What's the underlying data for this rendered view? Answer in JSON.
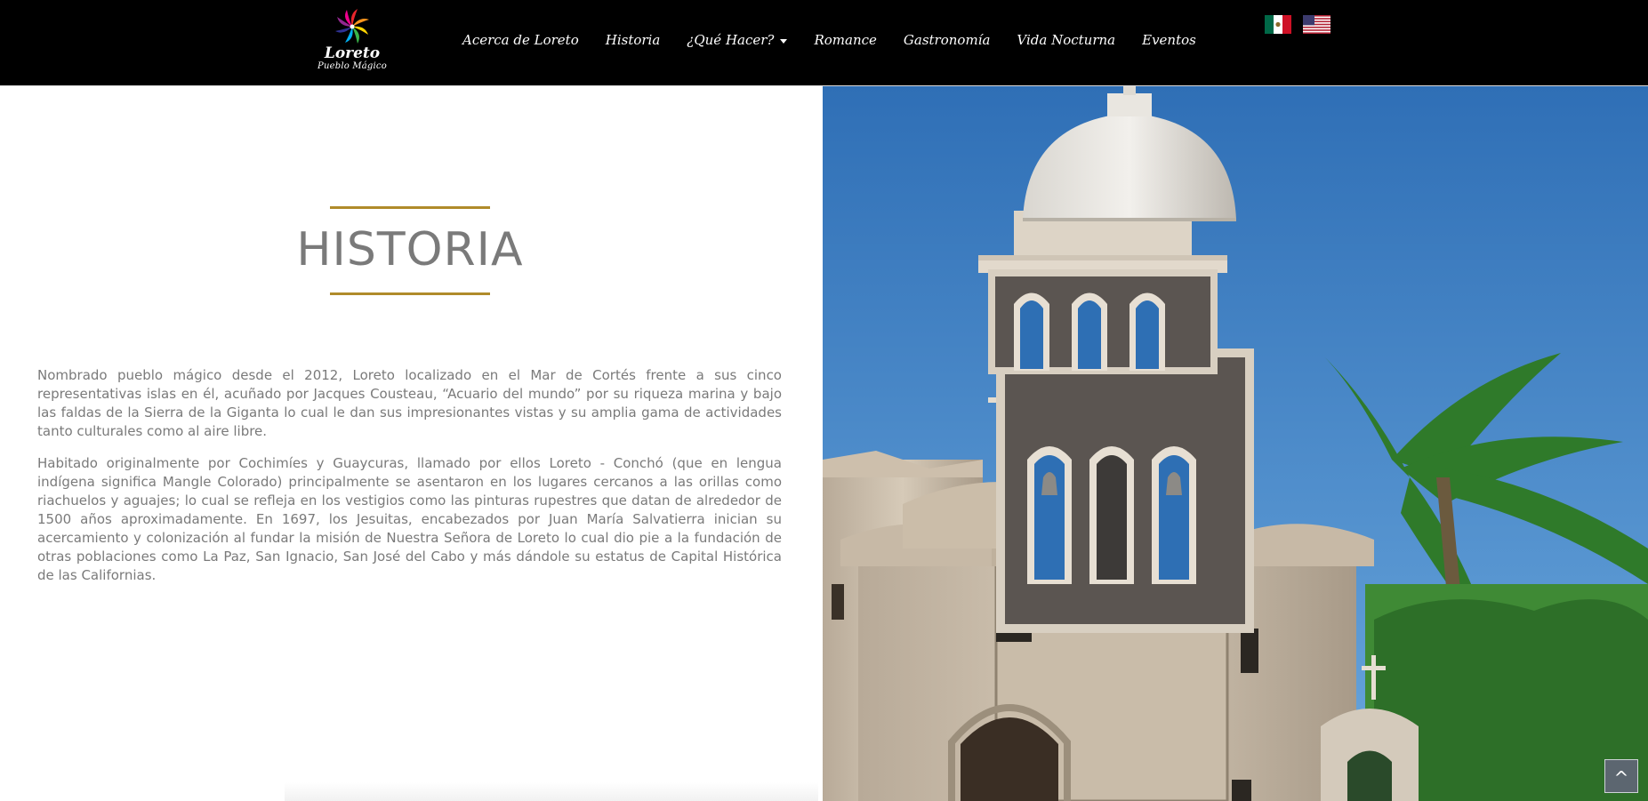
{
  "header": {
    "logo": {
      "name": "Loreto",
      "subtitle": "Pueblo Mágico"
    },
    "nav": [
      {
        "label": "Acerca de Loreto"
      },
      {
        "label": "Historia"
      },
      {
        "label": "¿Qué Hacer?",
        "dropdown": true
      },
      {
        "label": "Romance"
      },
      {
        "label": "Gastronomía"
      },
      {
        "label": "Vida Nocturna"
      },
      {
        "label": "Eventos"
      }
    ],
    "languages": [
      {
        "icon": "mexico-flag-icon"
      },
      {
        "icon": "usa-flag-icon"
      }
    ]
  },
  "main": {
    "title": "HISTORIA",
    "paragraphs": [
      "Nombrado pueblo mágico desde el 2012, Loreto localizado en el Mar de Cortés frente a sus cinco representativas islas en él, acuñado por Jacques Cousteau, “Acuario del mundo” por su riqueza marina y bajo las faldas de la Sierra de la Giganta lo cual le dan sus impresionantes vistas y su amplia gama de actividades tanto culturales como al aire libre.",
      "Habitado originalmente por Cochimíes y Guaycuras, llamado por ellos Loreto - Conchó (que en lengua indígena significa Mangle Colorado) principalmente se asentaron en los lugares cercanos a las orillas como riachuelos y aguajes; lo cual se refleja en los vestigios como las pinturas rupestres que datan de alrededor de 1500 años aproximadamente. En 1697, los Jesuitas, encabezados por Juan María Salvatierra inician su acercamiento y colonización al fundar la misión de Nuestra Señora de Loreto lo cual dio pie a la fundación de otras poblaciones como La Paz, San Ignacio, San José del Cabo y más dándole su estatus de Capital Histórica de las Californias."
    ]
  },
  "back_to_top": {
    "label": "^",
    "icon": "chevron-up-icon"
  },
  "colors": {
    "accent": "#b08b2a",
    "text": "#7a7a7a",
    "navbar": "#000000"
  }
}
